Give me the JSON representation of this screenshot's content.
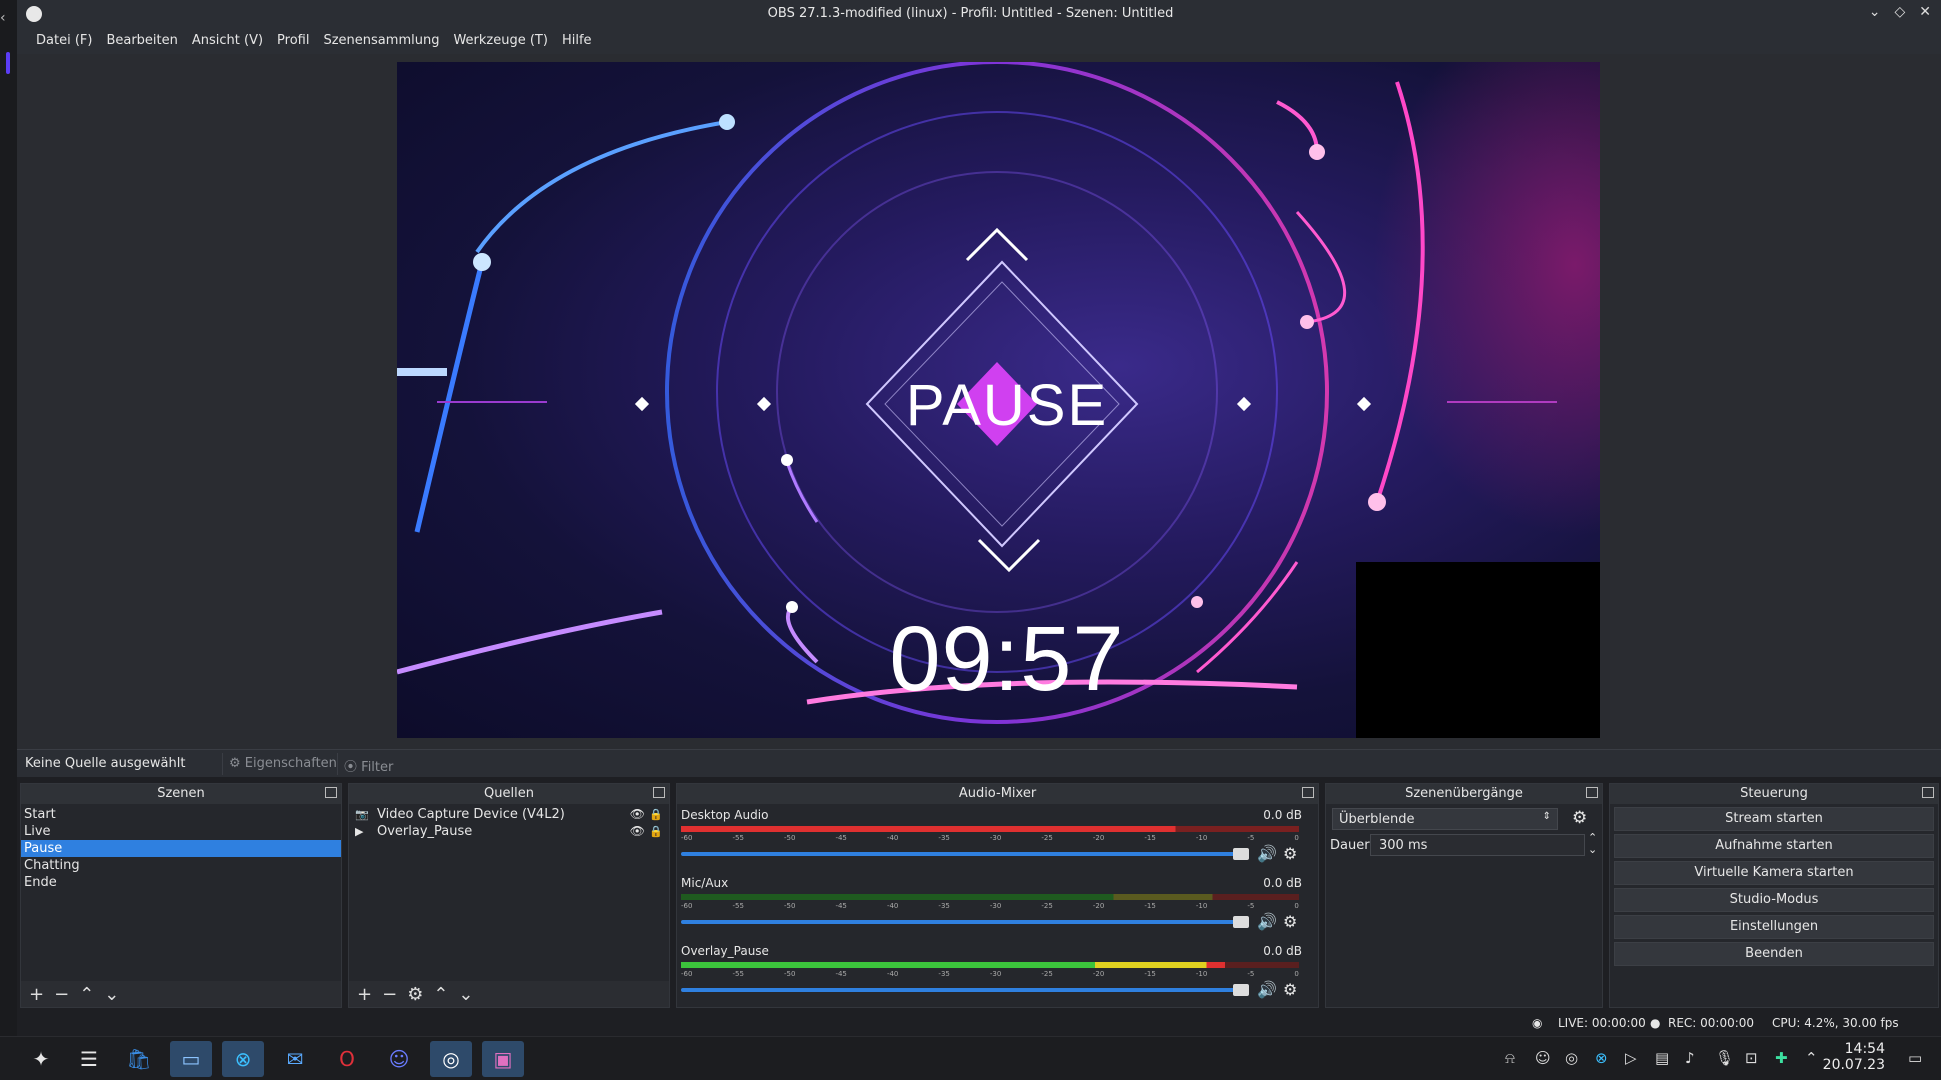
{
  "window": {
    "title": "OBS 27.1.3-modified (linux) - Profil: Untitled - Szenen: Untitled"
  },
  "menu": [
    "Datei (F)",
    "Bearbeiten",
    "Ansicht (V)",
    "Profil",
    "Szenensammlung",
    "Werkzeuge (T)",
    "Hilfe"
  ],
  "preview": {
    "pause_label": "PAUSE",
    "timer": "09:57"
  },
  "source_toolbar": {
    "no_source": "Keine Quelle ausgewählt",
    "properties": "Eigenschaften",
    "filter": "Filter"
  },
  "scenes": {
    "title": "Szenen",
    "items": [
      "Start",
      "Live",
      "Pause",
      "Chatting",
      "Ende"
    ],
    "selected": "Pause"
  },
  "sources": {
    "title": "Quellen",
    "items": [
      {
        "name": "Video Capture Device (V4L2)",
        "icon": "camera-icon"
      },
      {
        "name": "Overlay_Pause",
        "icon": "play-icon"
      }
    ]
  },
  "mixer": {
    "title": "Audio-Mixer",
    "scale": [
      "-60",
      "-55",
      "-50",
      "-45",
      "-40",
      "-35",
      "-30",
      "-25",
      "-20",
      "-15",
      "-10",
      "-5",
      "0"
    ],
    "channels": [
      {
        "name": "Desktop Audio",
        "db": "0.0 dB"
      },
      {
        "name": "Mic/Aux",
        "db": "0.0 dB"
      },
      {
        "name": "Overlay_Pause",
        "db": "0.0 dB"
      }
    ]
  },
  "transitions": {
    "title": "Szenenübergänge",
    "selected": "Überblende",
    "duration_label": "Dauer",
    "duration": "300 ms"
  },
  "controls": {
    "title": "Steuerung",
    "buttons": [
      "Stream starten",
      "Aufnahme starten",
      "Virtuelle Kamera starten",
      "Studio-Modus",
      "Einstellungen",
      "Beenden"
    ]
  },
  "status": {
    "live": "LIVE: 00:00:00",
    "rec": "REC: 00:00:00",
    "cpu": "CPU: 4.2%, 30.00 fps"
  },
  "clock": {
    "time": "14:54",
    "date": "20.07.23"
  },
  "colors": {
    "accent": "#2f80e0",
    "selection": "#2f80e0",
    "meter_green": "#3cc43c",
    "meter_yellow": "#e0d020",
    "meter_red": "#e03030"
  }
}
